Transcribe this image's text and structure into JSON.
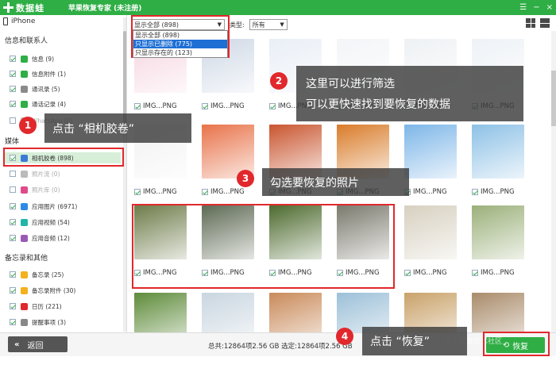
{
  "titlebar": {
    "logo_text": "数据蛙",
    "app_title": "苹果恢复专家 (未注册)",
    "controls": [
      "☰",
      "−",
      "×"
    ]
  },
  "sidebar": {
    "device": "iPhone",
    "section_info": "信息和联系人",
    "info_items": [
      {
        "label": "信息 (9)",
        "color": "#2fae45"
      },
      {
        "label": "信息附件 (1)",
        "color": "#2fae45"
      },
      {
        "label": "通讯录 (5)",
        "color": "#8a8a8a"
      },
      {
        "label": "通话记录 (4)",
        "color": "#2fae45"
      },
      {
        "label": "WhatsApp (0)",
        "color": "#bbb"
      }
    ],
    "section_media": "媒体",
    "media_items": [
      {
        "label": "相机胶卷 (898)",
        "color": "#3a7bd5"
      },
      {
        "label": "照片流 (0)",
        "color": "#bbb"
      },
      {
        "label": "照片库 (0)",
        "color": "#e04a88"
      },
      {
        "label": "应用图片 (6971)",
        "color": "#2d8ae6"
      },
      {
        "label": "应用视频 (54)",
        "color": "#1fb5a8"
      },
      {
        "label": "应用音频 (12)",
        "color": "#9b59b6"
      }
    ],
    "section_memo": "备忘录和其他",
    "memo_items": [
      {
        "label": "备忘录 (25)",
        "color": "#f3b11c"
      },
      {
        "label": "备忘录附件 (30)",
        "color": "#f3b11c"
      },
      {
        "label": "日历 (221)",
        "color": "#e1282c"
      },
      {
        "label": "提醒事项 (3)",
        "color": "#888"
      }
    ]
  },
  "toolbar": {
    "filter_value": "显示全部 (898)",
    "type_label": "类型:",
    "type_value": "所有"
  },
  "dropdown": {
    "options": [
      "显示全部 (898)",
      "只显示已删除 (775)",
      "只显示存在的 (123)"
    ],
    "selected_index": 1
  },
  "grid": {
    "rows": [
      [
        "IMG...PNG",
        "IMG...PNG",
        "IMG...PNG",
        "IMG...PNG",
        "IMG...PNG",
        "IMG...PNG"
      ],
      [
        "IMG...PNG",
        "IMG...PNG",
        "IMG...PNG",
        "IMG...PNG",
        "IMG...PNG",
        "IMG...PNG"
      ],
      [
        "IMG...PNG",
        "IMG...PNG",
        "IMG...PNG",
        "IMG...PNG",
        "IMG...PNG",
        "IMG...PNG"
      ],
      [
        "",
        "",
        "",
        "",
        "",
        ""
      ]
    ]
  },
  "annotations": {
    "step1": {
      "num": "1",
      "text": "点击 “相机胶卷”"
    },
    "step2": {
      "num": "2",
      "line1": "这里可以进行筛选",
      "line2": "可以更快速找到要恢复的数据"
    },
    "step3": {
      "num": "3",
      "text": "勾选要恢复的照片"
    },
    "step4": {
      "num": "4",
      "text": "点击 “恢复”"
    }
  },
  "footer": {
    "back_label": "返回",
    "stats": "总共:12864项2.56 GB 选定:12864项2.56 GB",
    "restore_label": "恢复",
    "watermark": "稀土掘金技术社区"
  },
  "colors": {
    "brand": "#2fae45",
    "annotation": "#e1282c",
    "highlight": "#1e6fd4"
  }
}
